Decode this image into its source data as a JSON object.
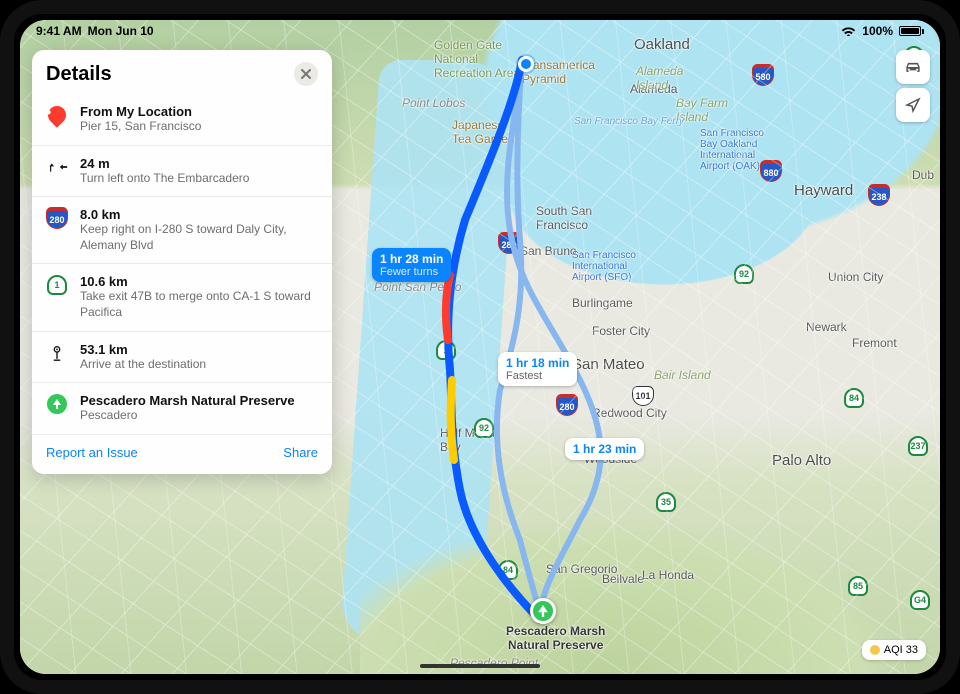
{
  "status": {
    "time": "9:41 AM",
    "date": "Mon Jun 10",
    "battery": "100%"
  },
  "panel": {
    "title": "Details",
    "report": "Report an Issue",
    "share": "Share"
  },
  "steps": [
    {
      "icon": "start-pin",
      "title": "From My Location",
      "sub": "Pier 15, San Francisco"
    },
    {
      "icon": "turn-left",
      "title": "24 m",
      "sub": "Turn left onto The Embarcadero"
    },
    {
      "icon": "i280",
      "title": "8.0 km",
      "sub": "Keep right on I-280 S toward Daly City, Alemany Blvd"
    },
    {
      "icon": "ca1",
      "title": "10.6 km",
      "sub": "Take exit 47B to merge onto CA-1 S toward Pacifica"
    },
    {
      "icon": "arrive",
      "title": "53.1 km",
      "sub": "Arrive at the destination"
    },
    {
      "icon": "dest",
      "title": "Pescadero Marsh Natural Preserve",
      "sub": "Pescadero"
    }
  ],
  "callouts": {
    "primary": {
      "title": "1 hr 28 min",
      "sub": "Fewer turns"
    },
    "alt1": {
      "title": "1 hr 18 min",
      "sub": "Fastest"
    },
    "alt2": {
      "title": "1 hr 23 min"
    }
  },
  "dest_label": {
    "name": "Pescadero Marsh",
    "name2": "Natural Preserve"
  },
  "aqi": {
    "label": "AQI 33"
  },
  "map_labels": {
    "oakland": "Oakland",
    "hayward": "Hayward",
    "sanmateo": "San Mateo",
    "paloalto": "Palo Alto",
    "fremont": "Fremont",
    "unioncity": "Union City",
    "newark": "Newark",
    "dublin": "Dub",
    "alameda": "Alameda",
    "southsf": "South San\nFrancisco",
    "sanbruno": "San Bruno",
    "burlingame": "Burlingame",
    "fostercity": "Foster City",
    "redwood": "Redwood City",
    "woodside": "Woodside",
    "halfmoon": "Half Moon\nBay",
    "sangregorio": "San Gregorio",
    "bellvale": "Bellvale",
    "lahonda": "La Honda",
    "pointlobos": "Point Lobos",
    "ptsanpedro": "Point San Pedro",
    "pescaderopt": "Pescadero Point",
    "bairisland": "Bair Island",
    "ggnra": "Golden Gate\nNational\nRecreation Area",
    "transamerica": "Transamerica\nPyramid",
    "tea": "Japanese\nTea Garden",
    "alamedais": "Alameda\nIsland",
    "bayfarm": "Bay Farm\nIsland",
    "sfo": "San Francisco\nInternational\nAirport (SFO)",
    "oak": "San Francisco\nBay Oakland\nInternational\nAirport (OAK)",
    "sfbayferry": "San Francisco Bay Ferry"
  },
  "shields": {
    "i280": "280",
    "i280b": "280",
    "i880": "880",
    "i580": "580",
    "i238": "238",
    "us101": "101",
    "ca1": "1",
    "ca92": "92",
    "ca84": "84",
    "ca84b": "84",
    "ca237": "237",
    "ca85": "85",
    "ca35": "35",
    "ca92b": "92",
    "g4": "G4",
    "ca4": "4"
  }
}
